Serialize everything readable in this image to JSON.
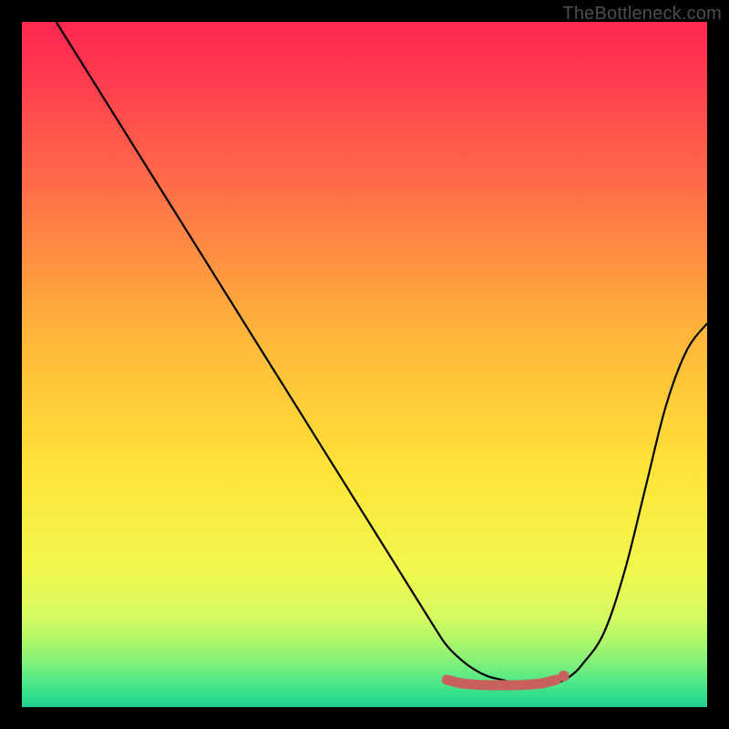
{
  "watermark": "TheBottleneck.com",
  "chart_data": {
    "type": "line",
    "title": "",
    "xlabel": "",
    "ylabel": "",
    "xlim": [
      0,
      100
    ],
    "ylim": [
      0,
      100
    ],
    "series": [
      {
        "name": "curve",
        "color": "#000000",
        "x": [
          5,
          10,
          15,
          20,
          25,
          30,
          35,
          40,
          45,
          50,
          55,
          60,
          62,
          64,
          66,
          68,
          70,
          72,
          74,
          76,
          78,
          80,
          82,
          85,
          88,
          91,
          94,
          97,
          100
        ],
        "y": [
          100,
          92,
          84,
          76,
          68,
          60,
          52,
          44,
          36,
          28,
          20,
          12,
          9,
          7,
          5.5,
          4.5,
          4.0,
          3.5,
          3.3,
          3.3,
          3.5,
          4.5,
          6.5,
          11,
          20,
          32,
          44,
          52,
          56
        ]
      },
      {
        "name": "flat-marker",
        "color": "#c8605d",
        "x": [
          62,
          64,
          66,
          68,
          70,
          72,
          74,
          76,
          78
        ],
        "y": [
          4.0,
          3.5,
          3.3,
          3.2,
          3.2,
          3.2,
          3.3,
          3.5,
          4.0
        ]
      }
    ],
    "gradient_stops": [
      {
        "offset": 0.0,
        "color": "#ff2850"
      },
      {
        "offset": 0.06,
        "color": "#ff3450"
      },
      {
        "offset": 0.25,
        "color": "#ff7148"
      },
      {
        "offset": 0.45,
        "color": "#ffb43a"
      },
      {
        "offset": 0.65,
        "color": "#ffe338"
      },
      {
        "offset": 0.8,
        "color": "#f2f84e"
      },
      {
        "offset": 0.87,
        "color": "#d4fa60"
      },
      {
        "offset": 0.91,
        "color": "#a6f66e"
      },
      {
        "offset": 0.94,
        "color": "#78ef7c"
      },
      {
        "offset": 0.965,
        "color": "#4de78a"
      },
      {
        "offset": 0.985,
        "color": "#30db8d"
      },
      {
        "offset": 1.0,
        "color": "#22cf8c"
      }
    ]
  }
}
